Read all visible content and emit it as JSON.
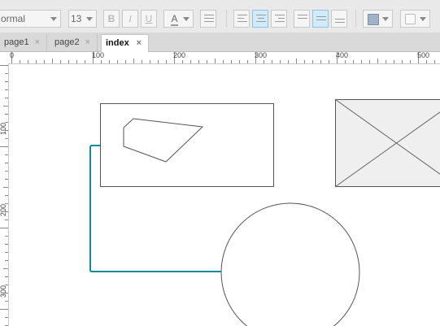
{
  "toolbar": {
    "style_value": "ormal",
    "font_size_value": "13",
    "bold_label": "B",
    "italic_label": "I",
    "underline_label": "U",
    "font_color_label": "A"
  },
  "tabs": [
    {
      "label": "page1",
      "close": "×"
    },
    {
      "label": "page2",
      "close": "×"
    },
    {
      "label": "index",
      "close": "×"
    }
  ],
  "ruler": {
    "h_labels": [
      "0",
      "100",
      "200",
      "300",
      "400",
      "500"
    ],
    "v_labels": [
      "100",
      "200",
      "300"
    ]
  },
  "colors": {
    "connector": "#138a9c",
    "placeholder_fill": "#efefef",
    "shape_stroke": "#555555"
  },
  "canvas": {
    "shapes": [
      "rectangle",
      "polygon",
      "image-placeholder",
      "circle",
      "connector"
    ]
  }
}
